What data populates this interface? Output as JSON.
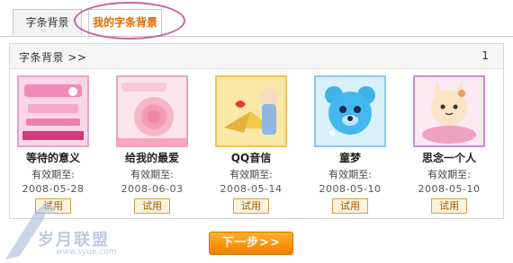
{
  "tabs": [
    {
      "label": "字条背景",
      "active": false
    },
    {
      "label": "我的字条背景",
      "active": true
    }
  ],
  "panel": {
    "title": "字条背景 >>",
    "page_number": "1"
  },
  "items": [
    {
      "name": "等待的意义",
      "valid_label": "有效期至:",
      "date": "2008-05-28",
      "button": "试用"
    },
    {
      "name": "给我的最爱",
      "valid_label": "有效期至:",
      "date": "2008-06-03",
      "button": "试用"
    },
    {
      "name": "QQ音信",
      "valid_label": "有效期至:",
      "date": "2008-05-14",
      "button": "试用"
    },
    {
      "name": "童梦",
      "valid_label": "有效期至:",
      "date": "2008-05-10",
      "button": "试用"
    },
    {
      "name": "思念一个人",
      "valid_label": "有效期至:",
      "date": "2008-05-10",
      "button": "试用"
    }
  ],
  "next_button": "下一步>>",
  "watermark": {
    "line1": "岁月联盟",
    "line2": "www.syue.com"
  },
  "colors": {
    "active_tab": "#e06a00",
    "ring": "#c8629f",
    "next_button": "#f57d00"
  }
}
